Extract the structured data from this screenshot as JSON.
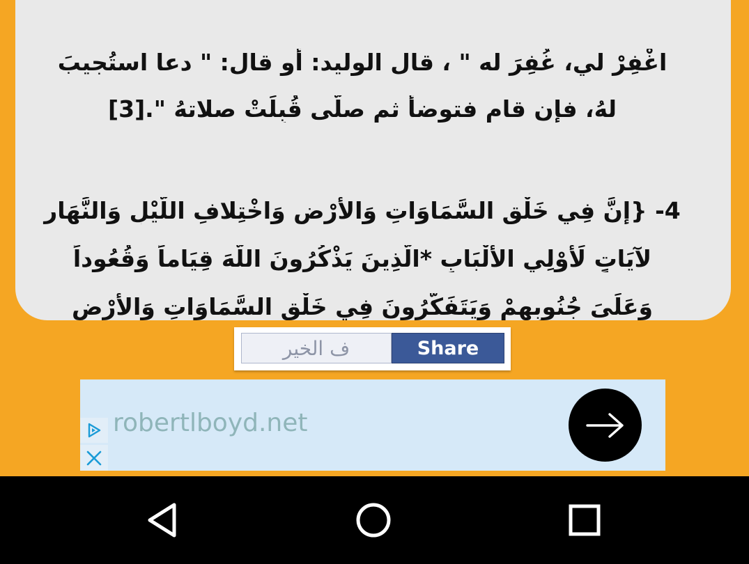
{
  "article": {
    "lines": [
      "اغْفِرْ لي، غُفِرَ له \" ، قال الوليد: أو قال: \" دعا استُجيبَ",
      "لهُ، فإن قام فتوضأ ثم صلّى قُبِلَتْ صلاتهُ \".[3]",
      "4-  {إِنَّ فِي خَلْقِ السَّمَاوَاتِ وَالأَرْضِ وَاخْتِلافِ اللَّيْلِ وَالنَّهَارِ",
      "لآيَاتٍ لِّأُوْلِي الألْبَابِ *الَّذِينَ يَذْكُرُونَ اللّهَ قِيَاماً وَقُعُوداً",
      "وَعَلَىَ جُنُوبِهِمْ وَيَتَفَكَّرُونَ فِي خَلْقِ السَّمَاوَاتِ وَالأَرْضِ"
    ]
  },
  "share": {
    "field_text": "ف الخير",
    "button_label": "Share",
    "button_color": "#3B5998"
  },
  "ad": {
    "url": "robertlboyd.net",
    "choices_icon": "adchoices-icon",
    "close_icon": "close-icon",
    "cta_icon": "arrow-right-icon"
  },
  "nav": {
    "back_icon": "back-triangle-icon",
    "home_icon": "home-circle-icon",
    "recents_icon": "recents-square-icon"
  },
  "colors": {
    "page_background": "#F5A623",
    "card_background": "#E9E9E9",
    "nav_background": "#000000"
  }
}
